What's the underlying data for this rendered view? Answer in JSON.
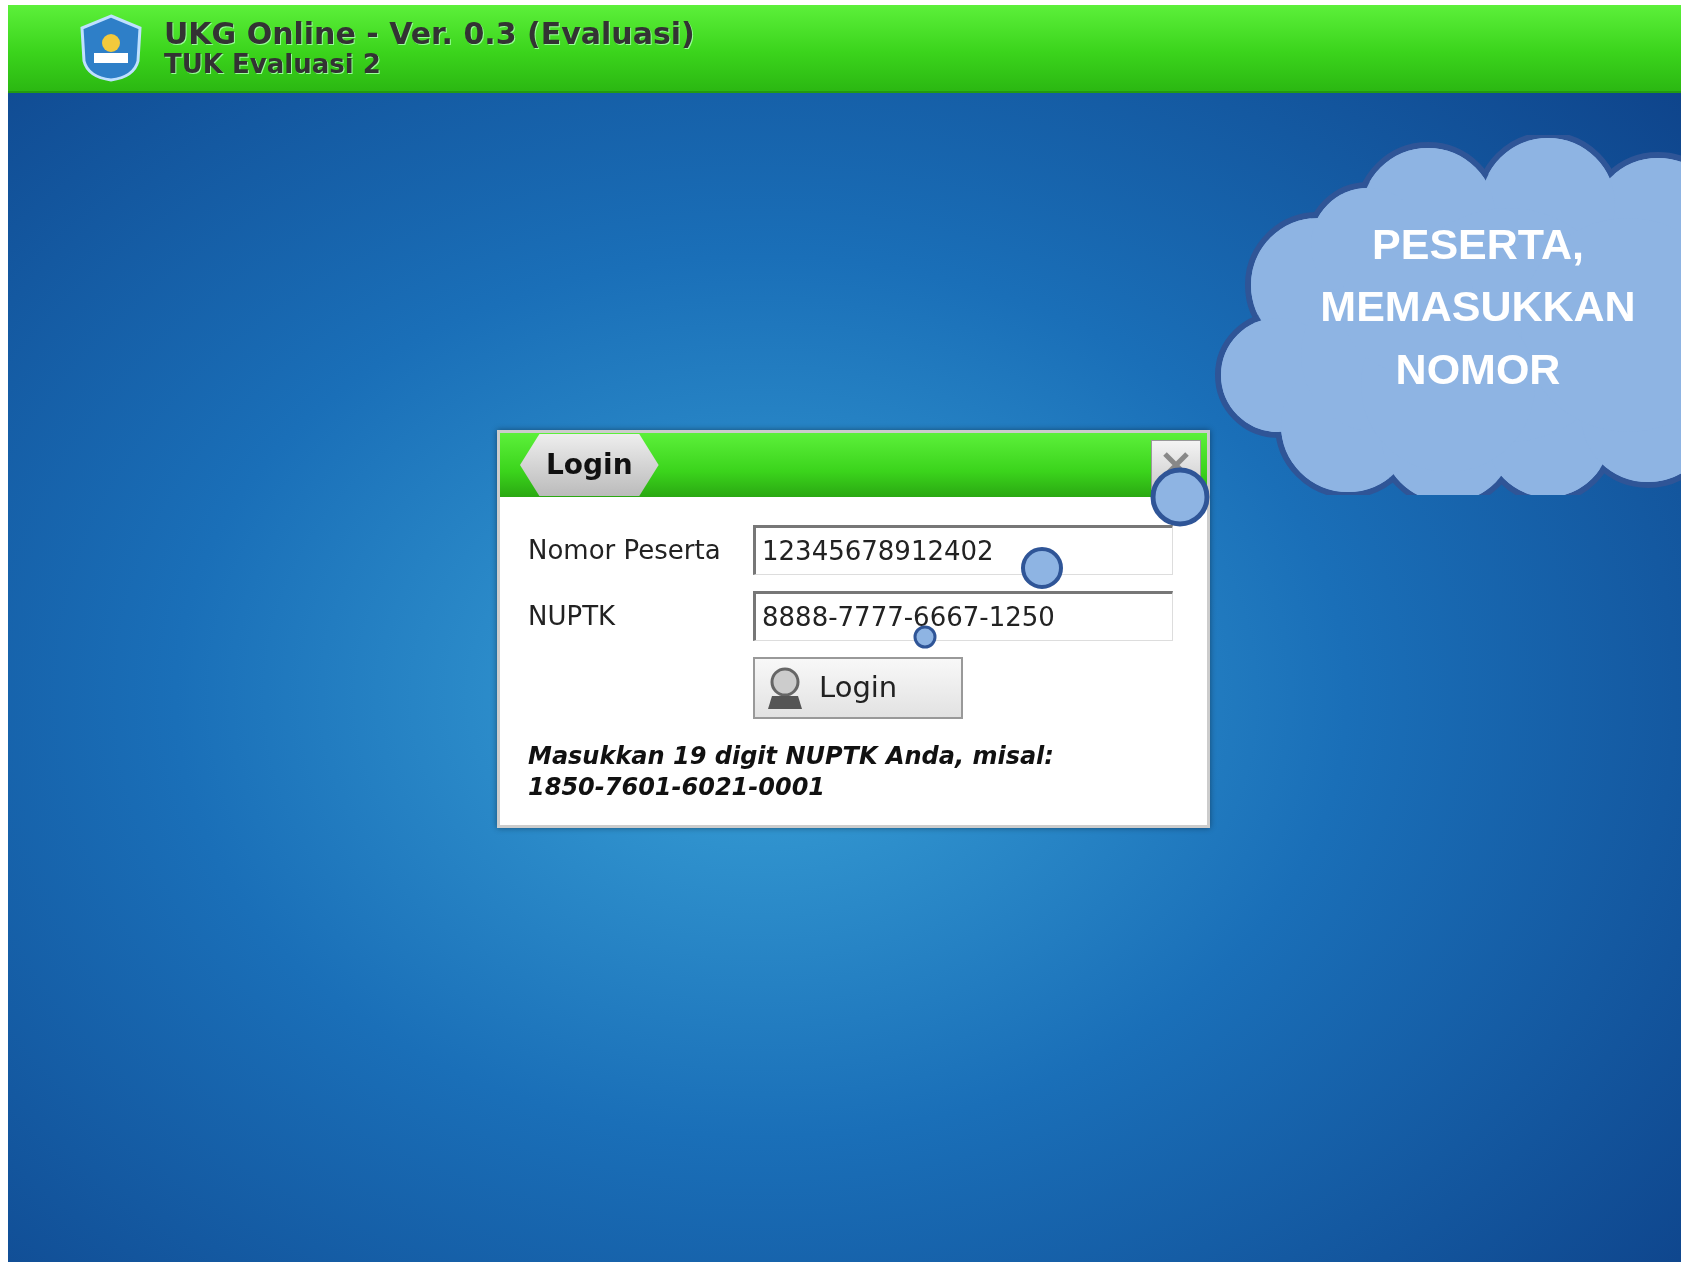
{
  "app_header": {
    "title": "UKG Online - Ver. 0.3 (Evaluasi)",
    "subtitle": "TUK Evaluasi 2"
  },
  "login_dialog": {
    "title": "Login",
    "fields": [
      {
        "label": "Nomor Peserta",
        "value": "12345678912402"
      },
      {
        "label": "NUPTK",
        "value": "8888-7777-6667-1250"
      }
    ],
    "button": "Login",
    "hint": "Masukkan 19 digit NUPTK Anda, misal: 1850-7601-6021-0001"
  },
  "callout": {
    "text": "PESERTA, MEMASUKKAN NOMOR"
  }
}
